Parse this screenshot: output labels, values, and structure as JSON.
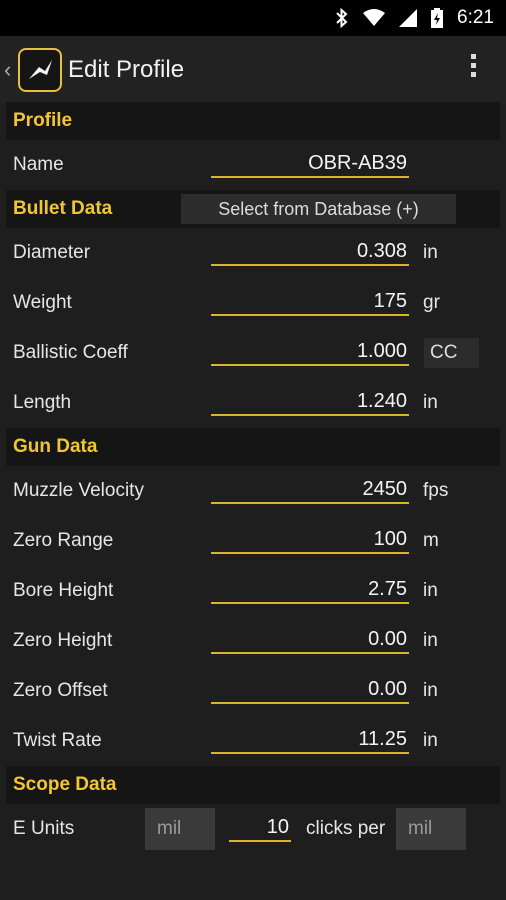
{
  "status_bar": {
    "time": "6:21"
  },
  "action_bar": {
    "title": "Edit Profile"
  },
  "sections": {
    "profile": "Profile",
    "bullet": "Bullet Data",
    "gun": "Gun Data",
    "scope": "Scope Data"
  },
  "profile": {
    "name_label": "Name",
    "name_value": "OBR-AB39"
  },
  "bullet": {
    "db_button": "Select from Database (+)",
    "diameter": {
      "label": "Diameter",
      "value": "0.308",
      "unit": "in"
    },
    "weight": {
      "label": "Weight",
      "value": "175",
      "unit": "gr"
    },
    "bc": {
      "label": "Ballistic Coeff",
      "value": "1.000",
      "unit": "CC"
    },
    "length": {
      "label": "Length",
      "value": "1.240",
      "unit": "in"
    }
  },
  "gun": {
    "muzzle_velocity": {
      "label": "Muzzle Velocity",
      "value": "2450",
      "unit": "fps"
    },
    "zero_range": {
      "label": "Zero Range",
      "value": "100",
      "unit": "m"
    },
    "bore_height": {
      "label": "Bore Height",
      "value": "2.75",
      "unit": "in"
    },
    "zero_height": {
      "label": "Zero Height",
      "value": "0.00",
      "unit": "in"
    },
    "zero_offset": {
      "label": "Zero Offset",
      "value": "0.00",
      "unit": "in"
    },
    "twist_rate": {
      "label": "Twist Rate",
      "value": "11.25",
      "unit": "in"
    }
  },
  "scope": {
    "e_units_label": "E Units",
    "e_units_value": "mil",
    "clicks_value": "10",
    "clicks_label": "clicks per",
    "clicks_unit": "mil"
  },
  "colors": {
    "accent": "#f2c533",
    "underline": "#d9b52c",
    "background": "#1e1e1e"
  }
}
